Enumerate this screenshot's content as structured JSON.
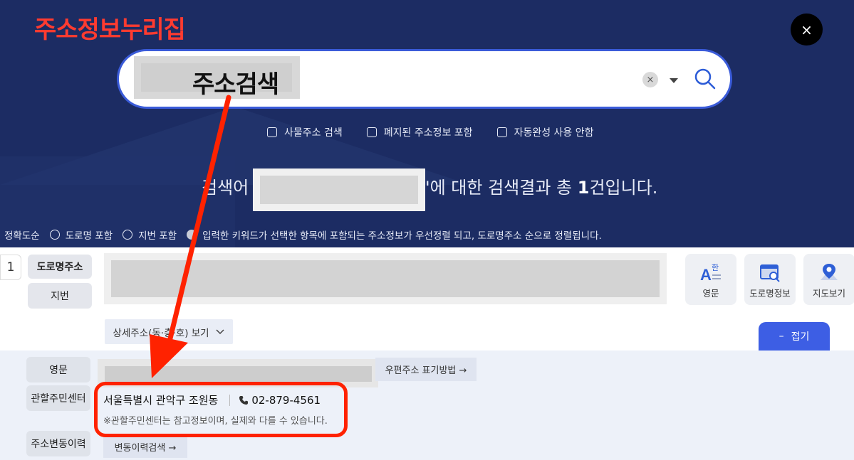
{
  "brand": {
    "title": "주소정보누리집",
    "color": "#ff3b30"
  },
  "header": {
    "close_label": "×"
  },
  "search": {
    "query": "주소검색",
    "clear_label": "×"
  },
  "options": [
    {
      "label": "사물주소 검색"
    },
    {
      "label": "폐지된 주소정보 포함"
    },
    {
      "label": "자동완성 사용 안함"
    }
  ],
  "result": {
    "prefix": "검색어",
    "suffix_open": "'에 대한 검색결과 총 ",
    "count": "1",
    "suffix_close": "건입니다."
  },
  "sort": {
    "label": "정확도순",
    "options": [
      "도로명 포함",
      "지번 포함"
    ],
    "note": "입력한 키워드가 선택한 항목에 포함되는 주소정보가 우선정렬 되고, 도로명주소 순으로 정렬됩니다."
  },
  "item": {
    "index": "1",
    "tag_road": "도로명주소",
    "tag_jibun": "지번",
    "tools": [
      {
        "label": "영문",
        "icon": "english-icon"
      },
      {
        "label": "도로명정보",
        "icon": "road-info-icon"
      },
      {
        "label": "지도보기",
        "icon": "map-pin-icon"
      }
    ],
    "detail_label": "상세주소(동·층·호) 보기",
    "fold_label": "접기"
  },
  "details": {
    "english_label": "영문",
    "postal_label": "우편주소 표기방법 →",
    "center_label": "관할주민센터",
    "center_name": "서울특별시 관악구 조원동",
    "center_phone": "02-879-4561",
    "center_note": "※관할주민센터는 참고정보이며, 실제와 다를 수 있습니다.",
    "history_label": "주소변동이력",
    "history_button": "변동이력검색 →"
  },
  "colors": {
    "background": "#1c2c63",
    "accent": "#3d5ee4",
    "annotation": "#ff2200"
  }
}
